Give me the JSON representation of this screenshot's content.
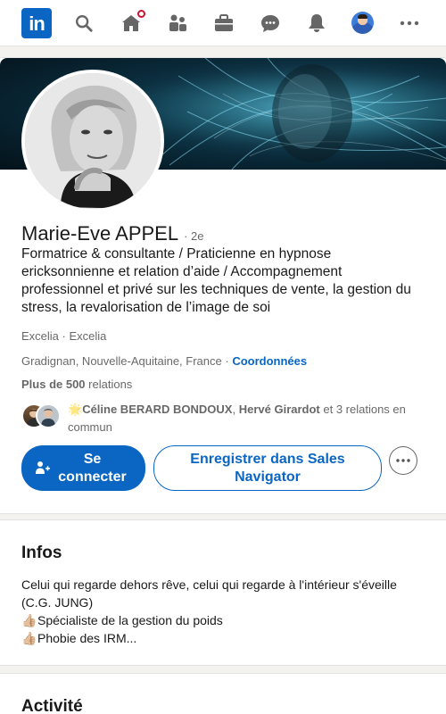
{
  "nav": {
    "logo_text": "in",
    "icons": [
      "search-icon",
      "home-icon",
      "network-icon",
      "jobs-icon",
      "messaging-icon",
      "notifications-icon",
      "avatar",
      "more-icon"
    ],
    "accent": "#0a66c2",
    "badge_color": "#cb112d"
  },
  "profile": {
    "name": "Marie-Eve APPEL",
    "degree": "· 2e",
    "headline": "Formatrice & consultante / Praticienne en hypnose ericksonnienne et relation d’aide / Accompagnement professionnel et privé sur les techniques de vente, la gestion du stress, la revalorisation de l’image de soi",
    "company": "Excelia · Excelia",
    "location": "Gradignan, Nouvelle-Aquitaine, France",
    "location_sep": " · ",
    "contact_link": "Coordonnées",
    "connections_count": "Plus de 500",
    "connections_label": " relations",
    "mutual": {
      "emoji": "🌟",
      "person1": "Céline BERARD BONDOUX",
      "sep": ", ",
      "person2": "Hervé Girardot",
      "rest": " et 3 relations en commun"
    },
    "connect_label": "Se connecter",
    "sales_label": "Enregistrer dans Sales Navigator",
    "more_icon": "ellipsis-icon"
  },
  "infos": {
    "title": "Infos",
    "line1": "Celui qui regarde dehors rêve, celui qui regarde à l'intérieur s'éveille (C.G. JUNG)",
    "thumb": "👍🏼",
    "line2": "Spécialiste de la gestion du poids",
    "line3": "Phobie des IRM..."
  },
  "activity": {
    "title": "Activité"
  }
}
